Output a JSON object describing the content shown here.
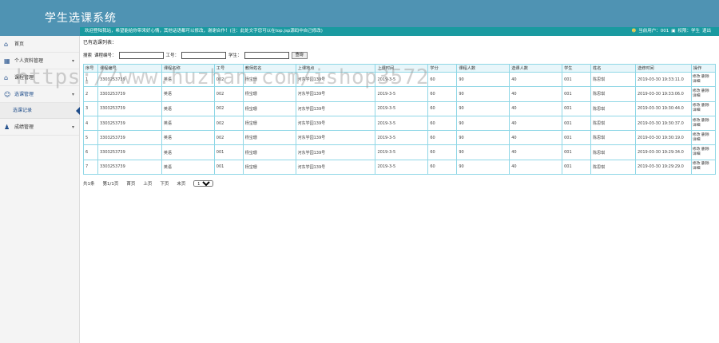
{
  "header": {
    "title": "学生选课系统",
    "welcome": "欢迎登陆我站，希望能给你带来好心情，其他话语都可以修改，谢谢合作！(注：此处文字您可以在top.jsp源码中自己修改)",
    "user_label": "当前用户：001",
    "role_label": "权限：学生",
    "logout": "退出"
  },
  "sidebar": {
    "items": [
      {
        "label": "首页"
      },
      {
        "label": "个人资料管理"
      },
      {
        "label": "课程管理"
      },
      {
        "label": "选课管理"
      },
      {
        "label": "选课记录"
      },
      {
        "label": "成绩管理"
      }
    ]
  },
  "main": {
    "section_label": "已有选课列表：",
    "search": {
      "search_label": "搜索",
      "course_no_label": "课程编号：",
      "job_no_label": "工号：",
      "student_no_label": "学生：",
      "button": "查询"
    },
    "table": {
      "headers": [
        "序号",
        "课程编号",
        "课程名称",
        "工号",
        "教师姓名",
        "上课地点",
        "上课时间",
        "学分",
        "课程人数",
        "选课人数",
        "学生",
        "姓名",
        "选修时间",
        "操作"
      ],
      "rows": [
        [
          "1",
          "3303253739",
          "英语",
          "002",
          "杨宝珊",
          "河东学园139号",
          "2019-3-5",
          "60",
          "90",
          "40",
          "001",
          "陈思琪",
          "2019-03-30 19:33:11.0"
        ],
        [
          "2",
          "3303253739",
          "英语",
          "002",
          "杨宝珊",
          "河东学园139号",
          "2019-3-5",
          "60",
          "90",
          "40",
          "001",
          "陈思琪",
          "2019-03-30 19:33:06.0"
        ],
        [
          "3",
          "3303253739",
          "英语",
          "002",
          "杨宝珊",
          "河东学园139号",
          "2019-3-5",
          "60",
          "90",
          "40",
          "001",
          "陈思琪",
          "2019-03-30 19:30:44.0"
        ],
        [
          "4",
          "3303253739",
          "英语",
          "002",
          "杨宝珊",
          "河东学园139号",
          "2019-3-5",
          "60",
          "90",
          "40",
          "001",
          "陈思琪",
          "2019-03-30 19:30:37.0"
        ],
        [
          "5",
          "3303253739",
          "英语",
          "002",
          "杨宝珊",
          "河东学园139号",
          "2019-3-5",
          "60",
          "90",
          "40",
          "001",
          "陈思琪",
          "2019-03-30 19:30:19.0"
        ],
        [
          "6",
          "3303253739",
          "英语",
          "001",
          "杨宝珊",
          "河东学园139号",
          "2019-3-5",
          "60",
          "90",
          "40",
          "001",
          "陈思琪",
          "2019-03-30 19:29:34.0"
        ],
        [
          "7",
          "3303253739",
          "英语",
          "001",
          "杨宝珊",
          "河东学园139号",
          "2019-3-5",
          "60",
          "90",
          "40",
          "001",
          "陈思琪",
          "2019-03-30 19:29:29.0"
        ]
      ],
      "op_edit": "修改",
      "op_delete": "删除",
      "op_detail": "详细"
    },
    "pager": {
      "total": "共1条",
      "page_of": "第1/1页",
      "first": "首页",
      "prev": "上页",
      "next": "下页",
      "last": "末页",
      "select_value": "1"
    }
  },
  "watermark": "https://www.huzhan.com/ishop3572"
}
